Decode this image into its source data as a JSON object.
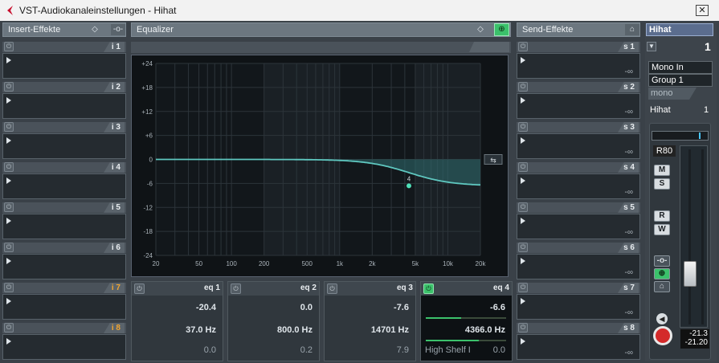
{
  "window": {
    "title": "VST-Audiokanaleinstellungen - Hihat",
    "close": "✕"
  },
  "insert": {
    "title": "Insert-Effekte",
    "slots": [
      {
        "label": "i 1",
        "orange": false
      },
      {
        "label": "i 2",
        "orange": false
      },
      {
        "label": "i 3",
        "orange": false
      },
      {
        "label": "i 4",
        "orange": false
      },
      {
        "label": "i 5",
        "orange": false
      },
      {
        "label": "i 6",
        "orange": false
      },
      {
        "label": "i 7",
        "orange": true
      },
      {
        "label": "i 8",
        "orange": true
      }
    ]
  },
  "equalizer": {
    "title": "Equalizer",
    "y_ticks": [
      "+24",
      "+18",
      "+12",
      "+6",
      "0",
      "-6",
      "-12",
      "-18",
      "-24"
    ],
    "x_ticks": [
      "20",
      "50",
      "100",
      "200",
      "500",
      "1k",
      "2k",
      "5k",
      "10k",
      "20k"
    ],
    "bands": [
      {
        "label": "eq 1",
        "gain": "-20.4",
        "freq": "37.0 Hz",
        "q": "0.0",
        "type": "",
        "active": false
      },
      {
        "label": "eq 2",
        "gain": "0.0",
        "freq": "800.0 Hz",
        "q": "0.2",
        "type": "",
        "active": false
      },
      {
        "label": "eq 3",
        "gain": "-7.6",
        "freq": "14701 Hz",
        "q": "7.9",
        "type": "",
        "active": false
      },
      {
        "label": "eq 4",
        "gain": "-6.6",
        "freq": "4366.0 Hz",
        "q": "0.0",
        "type": "High Shelf I",
        "active": true
      }
    ],
    "curve": {
      "type": "high-shelf",
      "freq_hz": 4366,
      "gain_db": -6.6,
      "point_label": "4"
    }
  },
  "send": {
    "title": "Send-Effekte",
    "slots": [
      {
        "label": "s 1",
        "value": "-∞"
      },
      {
        "label": "s 2",
        "value": "-∞"
      },
      {
        "label": "s 3",
        "value": "-∞"
      },
      {
        "label": "s 4",
        "value": "-∞"
      },
      {
        "label": "s 5",
        "value": "-∞"
      },
      {
        "label": "s 6",
        "value": "-∞"
      },
      {
        "label": "s 7",
        "value": "-∞"
      },
      {
        "label": "s 8",
        "value": "-∞"
      }
    ]
  },
  "channel": {
    "name": "Hihat",
    "number": "1",
    "input": "Mono In",
    "output": "Group 1",
    "mode": "mono",
    "track_name": "Hihat",
    "track_num": "1",
    "pan": "R80",
    "buttons": {
      "mute": "M",
      "solo": "S",
      "read": "R",
      "write": "W"
    },
    "meter_peak": "-21.3",
    "fader_value": "-21.20"
  },
  "colors": {
    "accent_green": "#3bc16b",
    "curve": "#5fc8c0",
    "active_label": "#f0a530"
  }
}
